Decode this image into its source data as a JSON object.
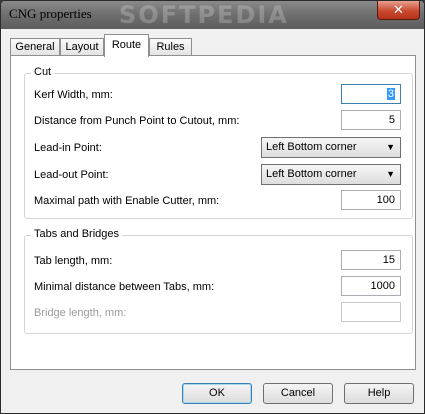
{
  "window": {
    "title": "CNG properties",
    "watermark": "SOFTPEDIA",
    "close_glyph": "✕"
  },
  "tabs": [
    {
      "label": "General",
      "active": false
    },
    {
      "label": "Layout",
      "active": false
    },
    {
      "label": "Route",
      "active": true
    },
    {
      "label": "Rules",
      "active": false
    }
  ],
  "cut": {
    "title": "Cut",
    "kerf_label": "Kerf Width, mm:",
    "kerf_value": "3",
    "distance_label": "Distance from Punch Point to Cutout, mm:",
    "distance_value": "5",
    "leadin_label": "Lead-in Point:",
    "leadin_value": "Left Bottom corner",
    "leadout_label": "Lead-out Point:",
    "leadout_value": "Left Bottom corner",
    "maxpath_label": "Maximal path with Enable Cutter, mm:",
    "maxpath_value": "100"
  },
  "tabs_bridges": {
    "title": "Tabs and Bridges",
    "tab_length_label": "Tab length, mm:",
    "tab_length_value": "15",
    "min_dist_label": "Minimal distance between Tabs, mm:",
    "min_dist_value": "1000",
    "bridge_label": "Bridge length, mm:",
    "bridge_value": ""
  },
  "buttons": {
    "ok": "OK",
    "cancel": "Cancel",
    "help": "Help"
  },
  "icons": {
    "combo_arrow": "dropdown-arrow-icon"
  }
}
